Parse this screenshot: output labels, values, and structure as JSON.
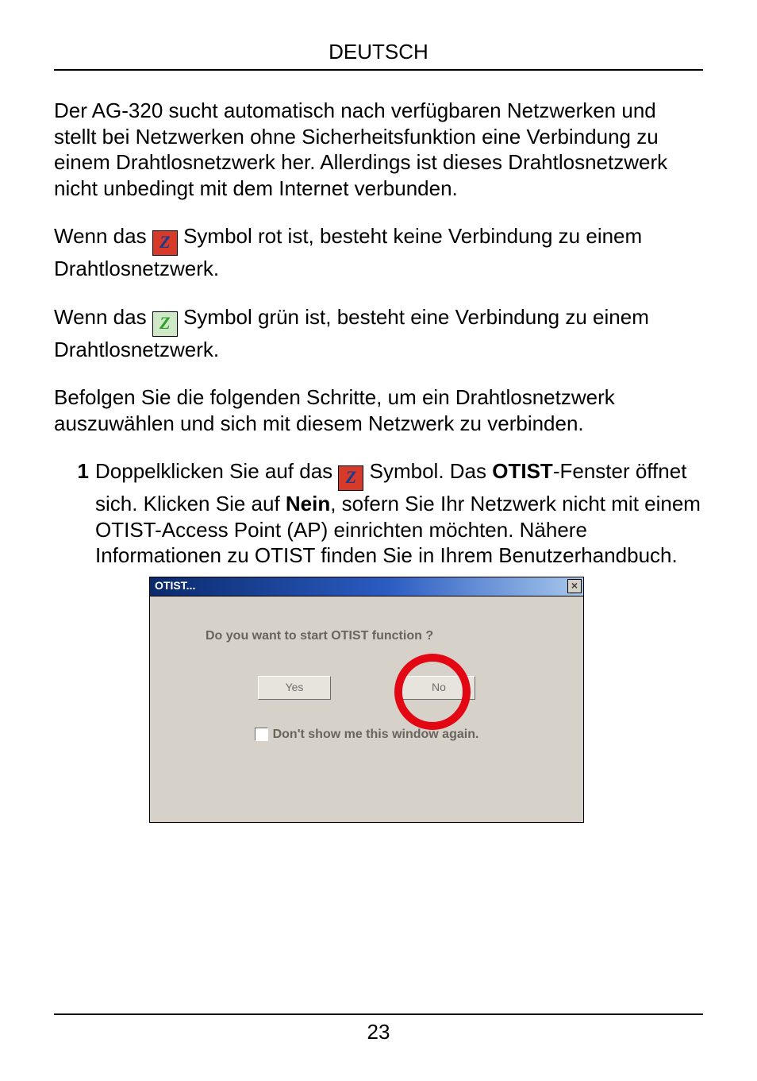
{
  "header": {
    "title": "DEUTSCH"
  },
  "body": {
    "p1": "Der AG-320 sucht automatisch nach verfügbaren Netzwerken und stellt bei Netzwerken ohne Sicherheitsfunktion eine Verbindung zu einem Drahtlosnetzwerk her. Allerdings ist dieses Drahtlosnetzwerk nicht unbedingt mit dem Internet verbunden.",
    "p2a": "Wenn das ",
    "p2b": " Symbol rot ist, besteht keine Verbindung zu einem Drahtlosnetzwerk.",
    "p3a": "Wenn das ",
    "p3b": " Symbol grün ist, besteht eine Verbindung zu einem Drahtlosnetzwerk.",
    "p4": "Befolgen Sie die folgenden Schritte, um ein Drahtlosnetzwerk auszuwählen und sich mit diesem Netzwerk zu verbinden.",
    "icon_glyph": "Z"
  },
  "step1": {
    "num": "1",
    "t1": "Doppelklicken Sie auf das ",
    "t2": " Symbol. Das ",
    "bold1": "OTIST",
    "t3": "-Fenster öffnet sich. Klicken Sie auf ",
    "bold2": "Nein",
    "t4": ", sofern Sie Ihr Netzwerk nicht mit einem OTIST-Access Point (AP) einrichten möchten. Nähere Informationen zu OTIST finden Sie in Ihrem Benutzerhandbuch."
  },
  "dialog": {
    "title": "OTIST...",
    "close_glyph": "×",
    "question": "Do you want to start OTIST function ?",
    "yes": "Yes",
    "no": "No",
    "checkbox_label": "Don't show me this window again."
  },
  "footer": {
    "page_no": "23"
  }
}
